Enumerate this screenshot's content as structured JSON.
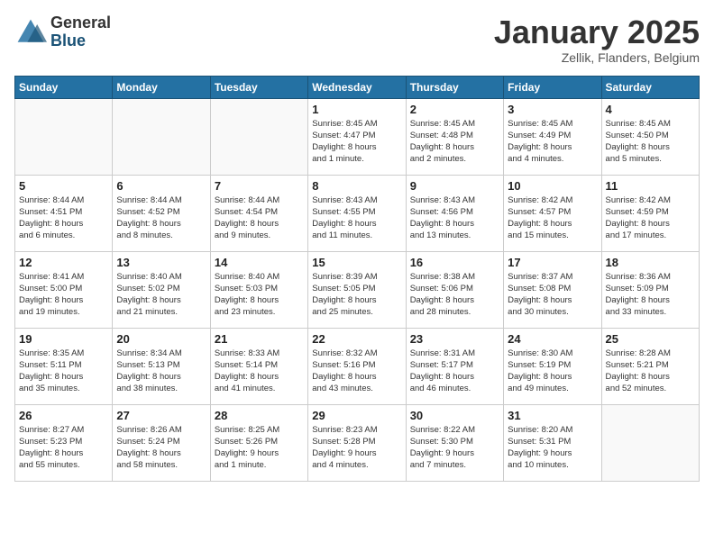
{
  "header": {
    "logo_general": "General",
    "logo_blue": "Blue",
    "title": "January 2025",
    "subtitle": "Zellik, Flanders, Belgium"
  },
  "weekdays": [
    "Sunday",
    "Monday",
    "Tuesday",
    "Wednesday",
    "Thursday",
    "Friday",
    "Saturday"
  ],
  "weeks": [
    [
      {
        "day": "",
        "info": ""
      },
      {
        "day": "",
        "info": ""
      },
      {
        "day": "",
        "info": ""
      },
      {
        "day": "1",
        "info": "Sunrise: 8:45 AM\nSunset: 4:47 PM\nDaylight: 8 hours\nand 1 minute."
      },
      {
        "day": "2",
        "info": "Sunrise: 8:45 AM\nSunset: 4:48 PM\nDaylight: 8 hours\nand 2 minutes."
      },
      {
        "day": "3",
        "info": "Sunrise: 8:45 AM\nSunset: 4:49 PM\nDaylight: 8 hours\nand 4 minutes."
      },
      {
        "day": "4",
        "info": "Sunrise: 8:45 AM\nSunset: 4:50 PM\nDaylight: 8 hours\nand 5 minutes."
      }
    ],
    [
      {
        "day": "5",
        "info": "Sunrise: 8:44 AM\nSunset: 4:51 PM\nDaylight: 8 hours\nand 6 minutes."
      },
      {
        "day": "6",
        "info": "Sunrise: 8:44 AM\nSunset: 4:52 PM\nDaylight: 8 hours\nand 8 minutes."
      },
      {
        "day": "7",
        "info": "Sunrise: 8:44 AM\nSunset: 4:54 PM\nDaylight: 8 hours\nand 9 minutes."
      },
      {
        "day": "8",
        "info": "Sunrise: 8:43 AM\nSunset: 4:55 PM\nDaylight: 8 hours\nand 11 minutes."
      },
      {
        "day": "9",
        "info": "Sunrise: 8:43 AM\nSunset: 4:56 PM\nDaylight: 8 hours\nand 13 minutes."
      },
      {
        "day": "10",
        "info": "Sunrise: 8:42 AM\nSunset: 4:57 PM\nDaylight: 8 hours\nand 15 minutes."
      },
      {
        "day": "11",
        "info": "Sunrise: 8:42 AM\nSunset: 4:59 PM\nDaylight: 8 hours\nand 17 minutes."
      }
    ],
    [
      {
        "day": "12",
        "info": "Sunrise: 8:41 AM\nSunset: 5:00 PM\nDaylight: 8 hours\nand 19 minutes."
      },
      {
        "day": "13",
        "info": "Sunrise: 8:40 AM\nSunset: 5:02 PM\nDaylight: 8 hours\nand 21 minutes."
      },
      {
        "day": "14",
        "info": "Sunrise: 8:40 AM\nSunset: 5:03 PM\nDaylight: 8 hours\nand 23 minutes."
      },
      {
        "day": "15",
        "info": "Sunrise: 8:39 AM\nSunset: 5:05 PM\nDaylight: 8 hours\nand 25 minutes."
      },
      {
        "day": "16",
        "info": "Sunrise: 8:38 AM\nSunset: 5:06 PM\nDaylight: 8 hours\nand 28 minutes."
      },
      {
        "day": "17",
        "info": "Sunrise: 8:37 AM\nSunset: 5:08 PM\nDaylight: 8 hours\nand 30 minutes."
      },
      {
        "day": "18",
        "info": "Sunrise: 8:36 AM\nSunset: 5:09 PM\nDaylight: 8 hours\nand 33 minutes."
      }
    ],
    [
      {
        "day": "19",
        "info": "Sunrise: 8:35 AM\nSunset: 5:11 PM\nDaylight: 8 hours\nand 35 minutes."
      },
      {
        "day": "20",
        "info": "Sunrise: 8:34 AM\nSunset: 5:13 PM\nDaylight: 8 hours\nand 38 minutes."
      },
      {
        "day": "21",
        "info": "Sunrise: 8:33 AM\nSunset: 5:14 PM\nDaylight: 8 hours\nand 41 minutes."
      },
      {
        "day": "22",
        "info": "Sunrise: 8:32 AM\nSunset: 5:16 PM\nDaylight: 8 hours\nand 43 minutes."
      },
      {
        "day": "23",
        "info": "Sunrise: 8:31 AM\nSunset: 5:17 PM\nDaylight: 8 hours\nand 46 minutes."
      },
      {
        "day": "24",
        "info": "Sunrise: 8:30 AM\nSunset: 5:19 PM\nDaylight: 8 hours\nand 49 minutes."
      },
      {
        "day": "25",
        "info": "Sunrise: 8:28 AM\nSunset: 5:21 PM\nDaylight: 8 hours\nand 52 minutes."
      }
    ],
    [
      {
        "day": "26",
        "info": "Sunrise: 8:27 AM\nSunset: 5:23 PM\nDaylight: 8 hours\nand 55 minutes."
      },
      {
        "day": "27",
        "info": "Sunrise: 8:26 AM\nSunset: 5:24 PM\nDaylight: 8 hours\nand 58 minutes."
      },
      {
        "day": "28",
        "info": "Sunrise: 8:25 AM\nSunset: 5:26 PM\nDaylight: 9 hours\nand 1 minute."
      },
      {
        "day": "29",
        "info": "Sunrise: 8:23 AM\nSunset: 5:28 PM\nDaylight: 9 hours\nand 4 minutes."
      },
      {
        "day": "30",
        "info": "Sunrise: 8:22 AM\nSunset: 5:30 PM\nDaylight: 9 hours\nand 7 minutes."
      },
      {
        "day": "31",
        "info": "Sunrise: 8:20 AM\nSunset: 5:31 PM\nDaylight: 9 hours\nand 10 minutes."
      },
      {
        "day": "",
        "info": ""
      }
    ]
  ]
}
